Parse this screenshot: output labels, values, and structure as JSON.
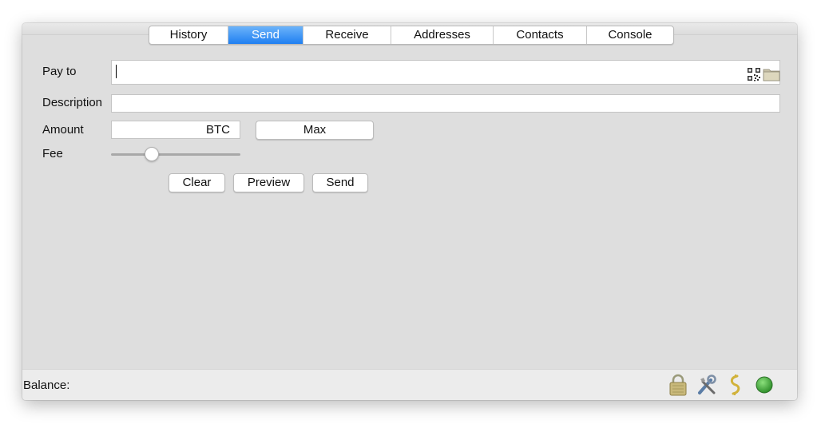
{
  "tabs": [
    {
      "label": "History",
      "active": false
    },
    {
      "label": "Send",
      "active": true
    },
    {
      "label": "Receive",
      "active": false
    },
    {
      "label": "Addresses",
      "active": false
    },
    {
      "label": "Contacts",
      "active": false
    },
    {
      "label": "Console",
      "active": false
    }
  ],
  "form": {
    "pay_to_label": "Pay to",
    "pay_to_value": "",
    "description_label": "Description",
    "description_value": "",
    "amount_label": "Amount",
    "amount_value": "",
    "amount_unit": "BTC",
    "max_button": "Max",
    "fee_label": "Fee",
    "fee_slider_level": 0.29
  },
  "actions": {
    "clear": "Clear",
    "preview": "Preview",
    "send": "Send"
  },
  "status": {
    "balance_label": "Balance:",
    "icons": [
      "lock-icon",
      "tools-icon",
      "seed-icon",
      "network-status-icon"
    ],
    "network_color": "#3ea63a"
  },
  "colors": {
    "accent": "#1f7ff1",
    "window_bg": "#dedede"
  }
}
